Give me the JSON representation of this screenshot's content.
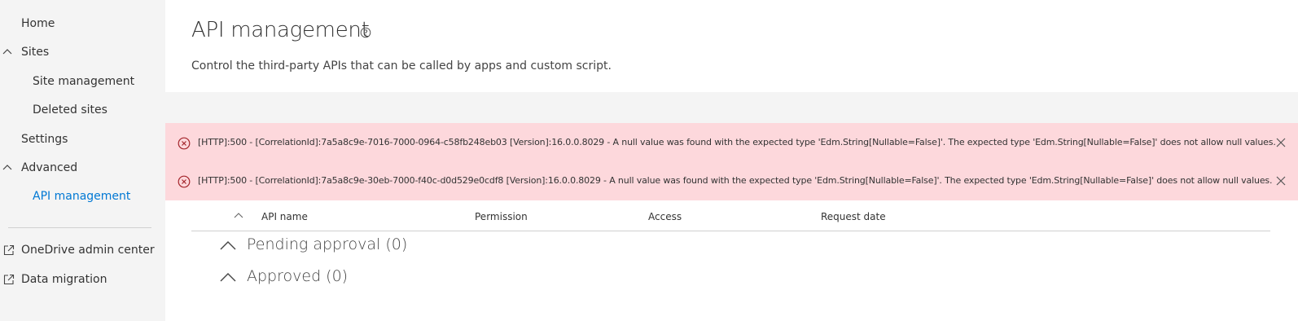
{
  "sidebar": {
    "items": [
      {
        "label": "Home"
      },
      {
        "label": "Sites"
      },
      {
        "label": "Site management"
      },
      {
        "label": "Deleted sites"
      },
      {
        "label": "Settings"
      },
      {
        "label": "Advanced"
      },
      {
        "label": "API management"
      },
      {
        "label": "OneDrive admin center"
      },
      {
        "label": "Data migration"
      }
    ]
  },
  "header": {
    "title": "API management",
    "description": "Control the third-party APIs that can be called by apps and custom script."
  },
  "errors": [
    {
      "text": "[HTTP]:500 -  [CorrelationId]:7a5a8c9e-7016-7000-0964-c58fb248eb03 [Version]:16.0.0.8029 - A null value was found with the expected type 'Edm.String[Nullable=False]'. The expected type 'Edm.String[Nullable=False]' does not allow null values."
    },
    {
      "text": "[HTTP]:500 -  [CorrelationId]:7a5a8c9e-30eb-7000-f40c-d0d529e0cdf8 [Version]:16.0.0.8029 - A null value was found with the expected type 'Edm.String[Nullable=False]'. The expected type 'Edm.String[Nullable=False]' does not allow null values."
    }
  ],
  "table": {
    "columns": [
      "API name",
      "Permission",
      "Access",
      "Request date"
    ]
  },
  "groups": [
    {
      "label": "Pending approval (0)"
    },
    {
      "label": "Approved (0)"
    }
  ],
  "colors": {
    "accent": "#0078d4",
    "error_background": "#fdd8dc",
    "error_icon": "#a4262c",
    "sidebar_background": "#f4f4f4"
  }
}
